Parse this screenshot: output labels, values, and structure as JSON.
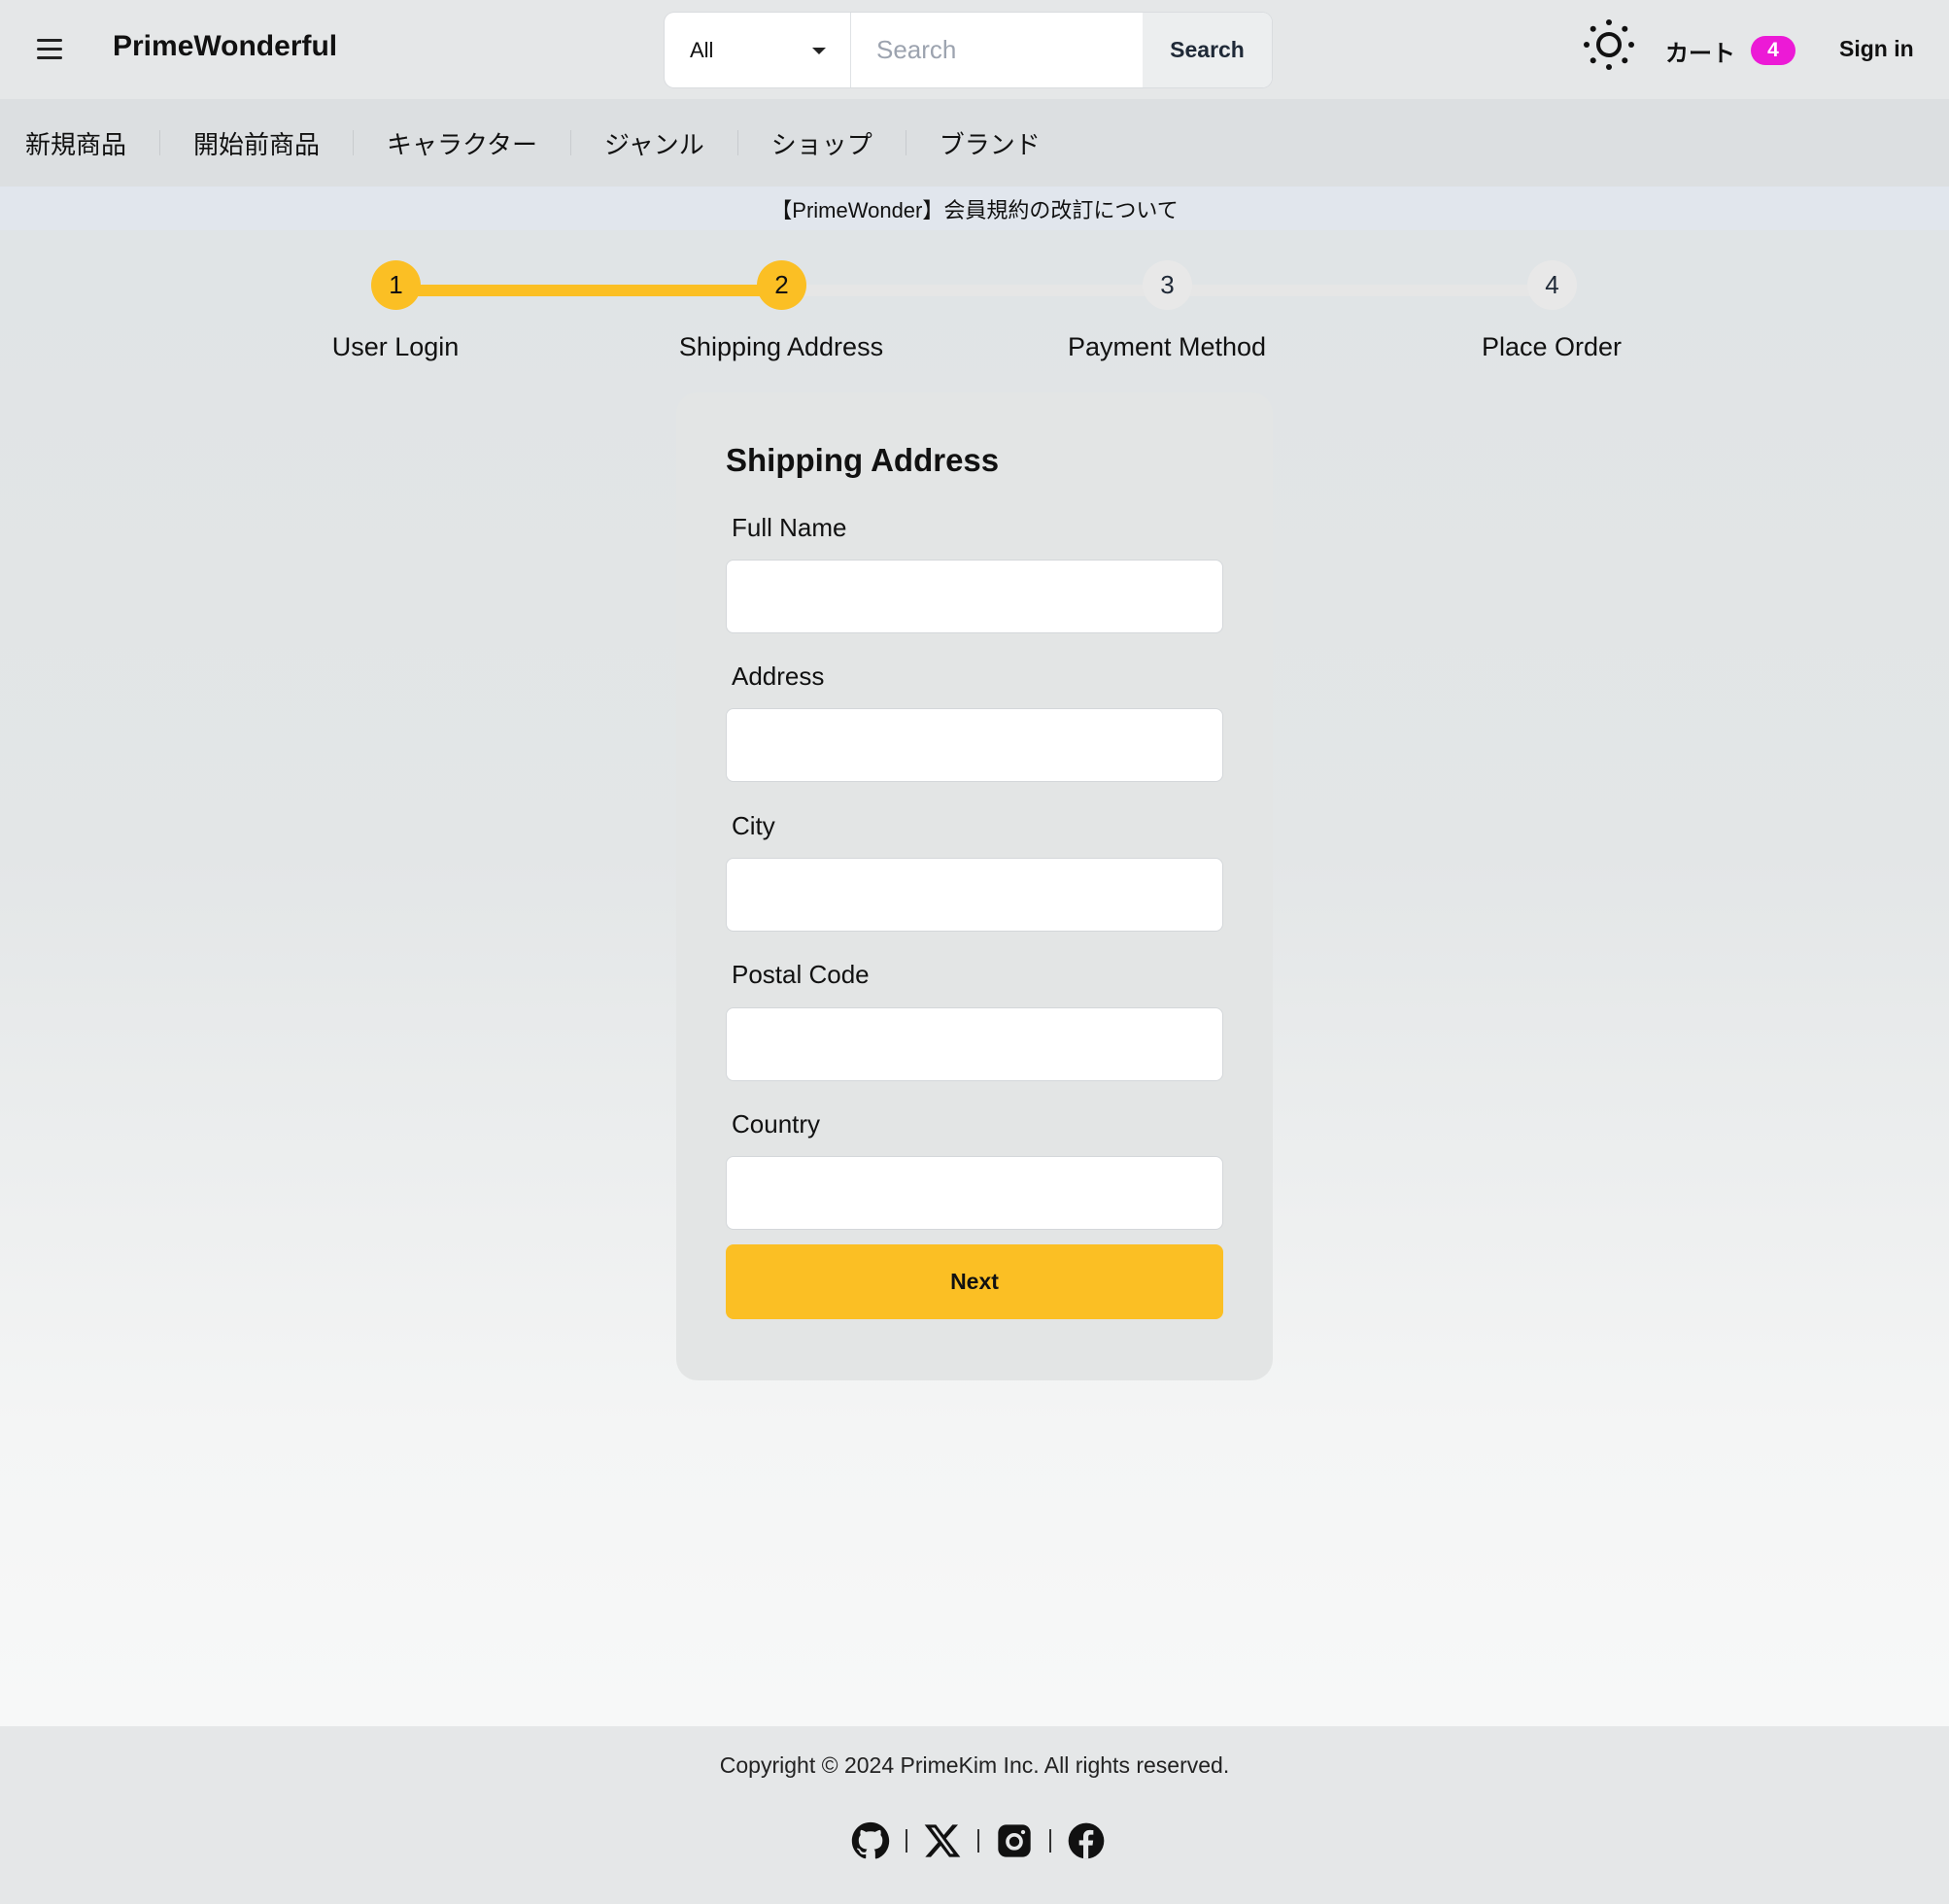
{
  "header": {
    "brand": "PrimeWonderful",
    "search_category": "All",
    "search_placeholder": "Search",
    "search_button": "Search",
    "cart_label": "カート",
    "cart_count": "4",
    "sign_in": "Sign in"
  },
  "nav": {
    "items": [
      {
        "label": "新規商品"
      },
      {
        "label": "開始前商品"
      },
      {
        "label": "キャラクター"
      },
      {
        "label": "ジャンル"
      },
      {
        "label": "ショップ"
      },
      {
        "label": "ブランド"
      }
    ]
  },
  "announcement": "【PrimeWonder】会員規約の改訂について",
  "steps": [
    {
      "number": "1",
      "label": "User Login",
      "active": true
    },
    {
      "number": "2",
      "label": "Shipping Address",
      "active": true
    },
    {
      "number": "3",
      "label": "Payment Method",
      "active": false
    },
    {
      "number": "4",
      "label": "Place Order",
      "active": false
    }
  ],
  "form": {
    "title": "Shipping Address",
    "fields": [
      {
        "label": "Full Name",
        "value": ""
      },
      {
        "label": "Address",
        "value": ""
      },
      {
        "label": "City",
        "value": ""
      },
      {
        "label": "Postal Code",
        "value": ""
      },
      {
        "label": "Country",
        "value": ""
      }
    ],
    "submit_label": "Next"
  },
  "footer": {
    "copyright": "Copyright © 2024 PrimeKim Inc. All rights reserved.",
    "socials": [
      "github-icon",
      "x-icon",
      "instagram-icon",
      "facebook-icon"
    ]
  },
  "colors": {
    "accent": "#fbbf24",
    "badge": "#ec1ad6",
    "inactive_step": "#e8e8e8"
  }
}
